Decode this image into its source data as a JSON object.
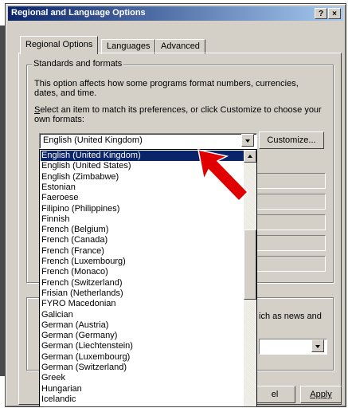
{
  "window": {
    "title": "Regional and Language Options",
    "help_label": "?",
    "close_label": "×"
  },
  "tabs": [
    {
      "label": "Regional Options"
    },
    {
      "label": "Languages"
    },
    {
      "label": "Advanced"
    }
  ],
  "standards": {
    "group_label": "Standards and formats",
    "description": "This option affects how some programs format numbers, currencies, dates, and time.",
    "select_prompt_underlined": "S",
    "select_prompt_rest": "elect an item to match its preferences, or click Customize to choose your own formats:",
    "selected_value": "English (United Kingdom)",
    "customize_label": "Customize..."
  },
  "location_fragment": "ich as news and",
  "dropdown": {
    "options": [
      "English (United Kingdom)",
      "English (United States)",
      "English (Zimbabwe)",
      "Estonian",
      "Faeroese",
      "Filipino (Philippines)",
      "Finnish",
      "French (Belgium)",
      "French (Canada)",
      "French (France)",
      "French (Luxembourg)",
      "French (Monaco)",
      "French (Switzerland)",
      "Frisian (Netherlands)",
      "FYRO Macedonian",
      "Galician",
      "German (Austria)",
      "German (Germany)",
      "German (Liechtenstein)",
      "German (Luxembourg)",
      "German (Switzerland)",
      "Greek",
      "Hungarian",
      "Icelandic"
    ],
    "selected_index": 0
  },
  "buttons": {
    "cancel_fragment": "el",
    "apply_label": "Apply"
  },
  "colors": {
    "highlight": "#0a246a",
    "annotation_arrow": "#e00000"
  }
}
